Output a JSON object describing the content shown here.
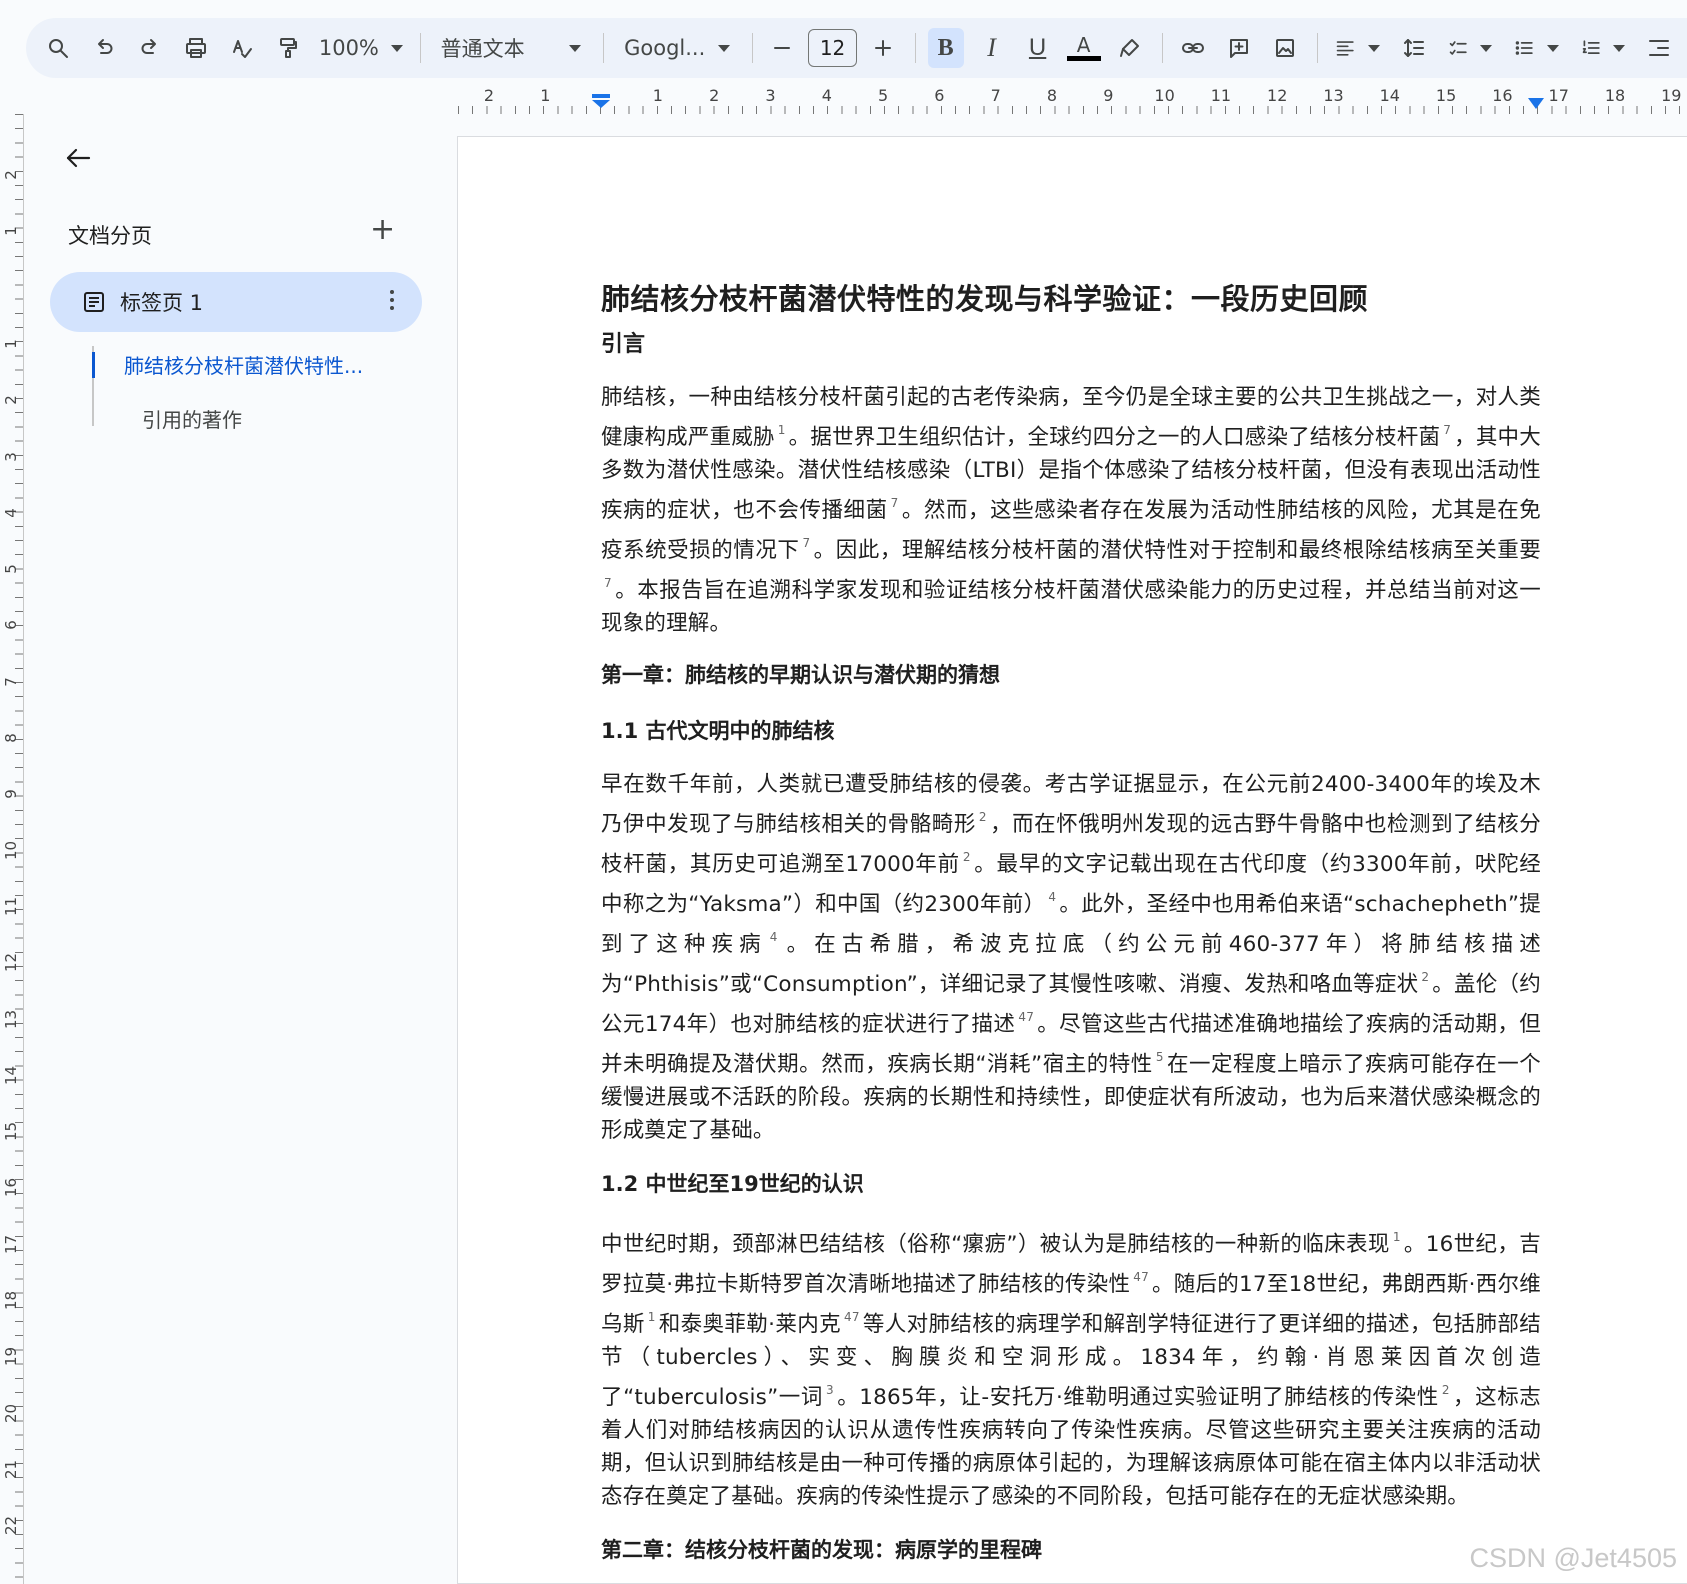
{
  "toolbar": {
    "zoom": "100%",
    "style": "普通文本",
    "font": "Googl...",
    "font_size": "12"
  },
  "ruler": {
    "h_labels": [
      "2",
      "1",
      "1",
      "2",
      "3",
      "4",
      "5",
      "6",
      "7",
      "8",
      "9",
      "10",
      "11",
      "12",
      "13",
      "14",
      "15",
      "16",
      "17",
      "18",
      "19"
    ],
    "v_labels": [
      "2",
      "1",
      "1",
      "2",
      "3",
      "4",
      "5",
      "6",
      "7",
      "8",
      "9",
      "10",
      "11",
      "12",
      "13",
      "14",
      "15",
      "16",
      "17",
      "18",
      "19",
      "20",
      "21",
      "22"
    ]
  },
  "sidebar": {
    "title": "文档分页",
    "tab_label": "标签页 1",
    "outline": [
      "肺结核分枝杆菌潜伏特性...",
      "引用的著作"
    ]
  },
  "document": {
    "title": "肺结核分枝杆菌潜伏特性的发现与科学验证：一段历史回顾",
    "intro_heading": "引言",
    "intro": [
      {
        "t": "肺结核，一种由结核分枝杆菌引起的古老传染病，至今仍是全球主要的公共卫生挑战之一，对人类健康构成严重威胁"
      },
      {
        "s": "1"
      },
      {
        "t": "。据世界卫生组织估计，全球约四分之一的人口感染了结核分枝杆菌"
      },
      {
        "s": "7"
      },
      {
        "t": "，其中大多数为潜伏性感染。潜伏性结核感染（LTBI）是指个体感染了结核分枝杆菌，但没有表现出活动性疾病的症状，也不会传播细菌"
      },
      {
        "s": "7"
      },
      {
        "t": "。然而，这些感染者存在发展为活动性肺结核的风险，尤其是在免疫系统受损的情况下"
      },
      {
        "s": "7"
      },
      {
        "t": "。因此，理解结核分枝杆菌的潜伏特性对于控制和最终根除结核病至关重要"
      },
      {
        "s": "7"
      },
      {
        "t": "。本报告旨在追溯科学家发现和验证结核分枝杆菌潜伏感染能力的历史过程，并总结当前对这一现象的理解。"
      }
    ],
    "chapter1_heading": "第一章：肺结核的早期认识与潜伏期的猜想",
    "section11_heading": "1.1 古代文明中的肺结核",
    "section11": [
      {
        "t": "早在数千年前，人类就已遭受肺结核的侵袭。考古学证据显示，在公元前2400-3400年的埃及木乃伊中发现了与肺结核相关的骨骼畸形"
      },
      {
        "s": "2"
      },
      {
        "t": "，而在怀俄明州发现的远古野牛骨骼中也检测到了结核分枝杆菌，其历史可追溯至17000年前"
      },
      {
        "s": "2"
      },
      {
        "t": "。最早的文字记载出现在古代印度（约3300年前，吠陀经中称之为“Yaksma”）和中国（约2300年前）"
      },
      {
        "s": "4"
      },
      {
        "t": "。此外，圣经中也用希伯来语“schachepheth”提到了这种疾病"
      },
      {
        "s": "4"
      },
      {
        "t": "。在古希腊，希波克拉底（约公元前460-377年）将肺结核描述为“Phthisis”或“Consumption”，详细记录了其慢性咳嗽、消瘦、发热和咯血等症状"
      },
      {
        "s": "2"
      },
      {
        "t": "。盖伦（约公元174年）也对肺结核的症状进行了描述"
      },
      {
        "s": "47"
      },
      {
        "t": "。尽管这些古代描述准确地描绘了疾病的活动期，但并未明确提及潜伏期。然而，疾病长期“消耗”宿主的特性"
      },
      {
        "s": "5"
      },
      {
        "t": "在一定程度上暗示了疾病可能存在一个缓慢进展或不活跃的阶段。疾病的长期性和持续性，即使症状有所波动，也为后来潜伏感染概念的形成奠定了基础。"
      }
    ],
    "section12_heading": "1.2 中世纪至19世纪的认识",
    "section12": [
      {
        "t": "中世纪时期，颈部淋巴结结核（俗称“瘰疬”）被认为是肺结核的一种新的临床表现"
      },
      {
        "s": "1"
      },
      {
        "t": "。16世纪，吉罗拉莫·弗拉卡斯特罗首次清晰地描述了肺结核的传染性"
      },
      {
        "s": "47"
      },
      {
        "t": "。随后的17至18世纪，弗朗西斯·西尔维乌斯"
      },
      {
        "s": "1"
      },
      {
        "t": "和泰奥菲勒·莱内克"
      },
      {
        "s": "47"
      },
      {
        "t": "等人对肺结核的病理学和解剖学特征进行了更详细的描述，包括肺部结节（tubercles）、实变、胸膜炎和空洞形成。1834年，约翰·肖恩莱因首次创造了“tuberculosis”一词"
      },
      {
        "s": "3"
      },
      {
        "t": "。1865年，让-安托万·维勒明通过实验证明了肺结核的传染性"
      },
      {
        "s": "2"
      },
      {
        "t": "，这标志着人们对肺结核病因的认识从遗传性疾病转向了传染性疾病。尽管这些研究主要关注疾病的活动期，但认识到肺结核是由一种可传播的病原体引起的，为理解该病原体可能在宿主体内以非活动状态存在奠定了基础。疾病的传染性提示了感染的不同阶段，包括可能存在的无症状感染期。"
      }
    ],
    "chapter2_heading": "第二章：结核分枝杆菌的发现：病原学的里程碑"
  },
  "watermark": "CSDN @Jet4505"
}
